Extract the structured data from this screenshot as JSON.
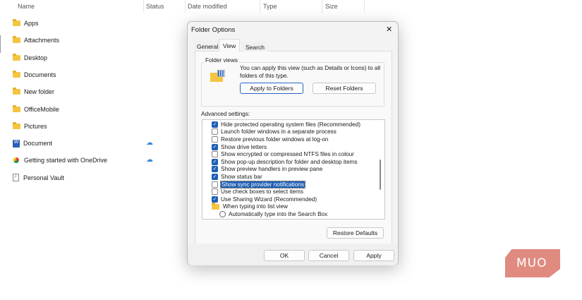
{
  "explorer": {
    "columns": [
      "Name",
      "Status",
      "Date modified",
      "Type",
      "Size"
    ],
    "items": [
      {
        "name": "Apps",
        "icon": "folder-icon",
        "cloud": false
      },
      {
        "name": "Attachments",
        "icon": "folder-icon",
        "cloud": false
      },
      {
        "name": "Desktop",
        "icon": "folder-icon",
        "cloud": false
      },
      {
        "name": "Documents",
        "icon": "folder-icon",
        "cloud": false
      },
      {
        "name": "New folder",
        "icon": "folder-icon",
        "cloud": false
      },
      {
        "name": "OfficeMobile",
        "icon": "folder-icon",
        "cloud": false
      },
      {
        "name": "Pictures",
        "icon": "folder-icon",
        "cloud": false
      },
      {
        "name": "Document",
        "icon": "word-doc-icon",
        "cloud": true
      },
      {
        "name": "Getting started with OneDrive",
        "icon": "chrome-pdf-icon",
        "cloud": true
      },
      {
        "name": "Personal Vault",
        "icon": "shortcut-icon",
        "cloud": false
      }
    ]
  },
  "dialog": {
    "title": "Folder Options",
    "close": "✕",
    "tabs": [
      "General",
      "View",
      "Search"
    ],
    "active_tab": "View",
    "folder_views": {
      "label": "Folder views",
      "description": "You can apply this view (such as Details or Icons) to all folders of this type.",
      "apply": "Apply to Folders",
      "reset": "Reset Folders"
    },
    "advanced_label": "Advanced settings:",
    "settings": [
      {
        "label": "Hide protected operating system files (Recommended)",
        "type": "checkbox",
        "checked": true
      },
      {
        "label": "Launch folder windows in a separate process",
        "type": "checkbox",
        "checked": false
      },
      {
        "label": "Restore previous folder windows at log-on",
        "type": "checkbox",
        "checked": false
      },
      {
        "label": "Show drive letters",
        "type": "checkbox",
        "checked": true
      },
      {
        "label": "Show encrypted or compressed NTFS files in colour",
        "type": "checkbox",
        "checked": false
      },
      {
        "label": "Show pop-up description for folder and desktop items",
        "type": "checkbox",
        "checked": true
      },
      {
        "label": "Show preview handlers in preview pane",
        "type": "checkbox",
        "checked": true
      },
      {
        "label": "Show status bar",
        "type": "checkbox",
        "checked": true
      },
      {
        "label": "Show sync provider notifications",
        "type": "checkbox",
        "checked": false,
        "selected": true
      },
      {
        "label": "Use check boxes to select items",
        "type": "checkbox",
        "checked": false
      },
      {
        "label": "Use Sharing Wizard (Recommended)",
        "type": "checkbox",
        "checked": true
      },
      {
        "label": "When typing into list view",
        "type": "group"
      },
      {
        "label": "Automatically type into the Search Box",
        "type": "radio",
        "checked": false
      }
    ],
    "restore_defaults": "Restore Defaults",
    "ok": "OK",
    "cancel": "Cancel",
    "apply": "Apply"
  },
  "watermark": "MUO",
  "colors": {
    "accent": "#1f5fb5",
    "folder": "#f5c542",
    "watermark": "#e08a80"
  }
}
